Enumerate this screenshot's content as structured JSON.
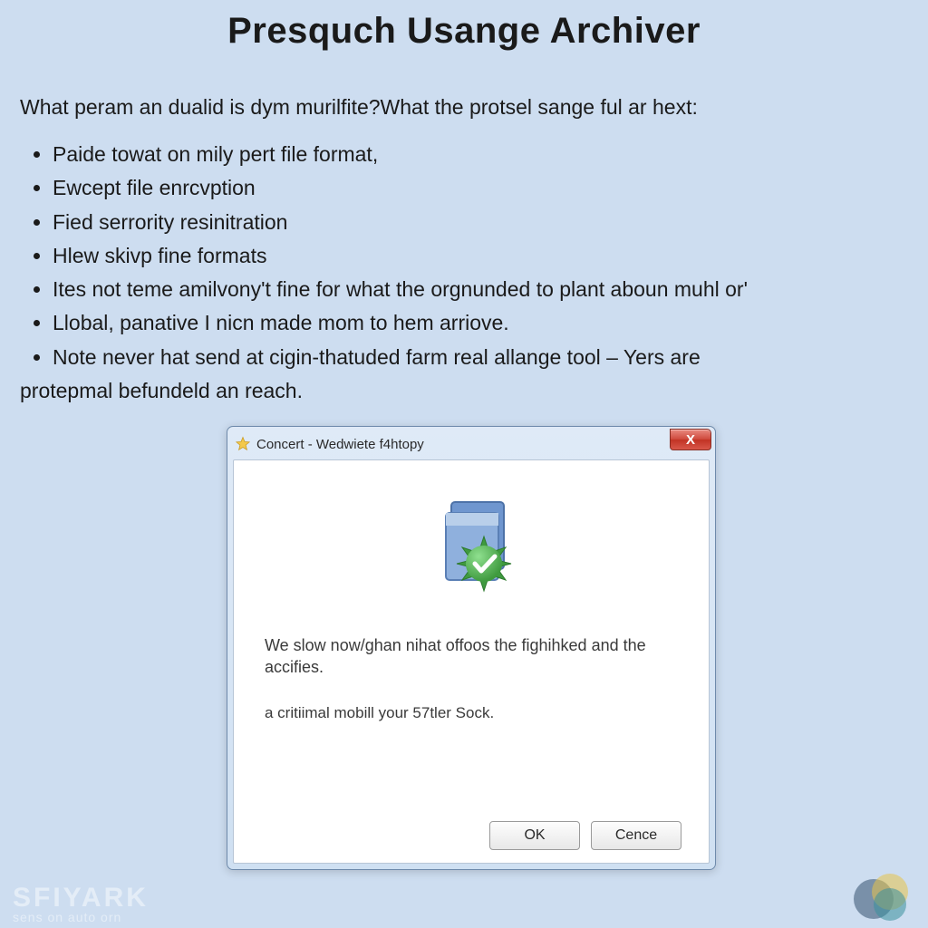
{
  "page": {
    "title": "Presquch Usange Archiver",
    "intro": "What peram an dualid is dym murilfite?What the protsel sange ful ar hext:",
    "bullets": [
      "Paide towat on mily pert file format,",
      "Ewcept file enrcvption",
      "Fied serrority resinitration",
      "Hlew skivp fine formats",
      "Ites not teme amilvony't fine for what the orgnunded to plant aboun muhl or'",
      "Llobal, panative I nicn made mom to hem arriove.",
      "Note never hat send at cigin-thatuded farm real allange tool – Yers are"
    ],
    "bullet_outdent": "protepmal befundeld an reach."
  },
  "dialog": {
    "title": "Concert - Wedwiete f4htopy",
    "close_label": "X",
    "message1": "We slow now/ghan nihat offoos the fighihked and the accifies.",
    "message2": "a critiimal mobill your 57tler Sock.",
    "ok_label": "OK",
    "cancel_label": "Cence"
  },
  "brand": {
    "name": "SFIYARK",
    "tagline": "sens on auto orn"
  },
  "icons": {
    "title_icon": "star-icon",
    "body_icon": "document-check-icon",
    "footer_logo": "overlap-circles-icon"
  }
}
